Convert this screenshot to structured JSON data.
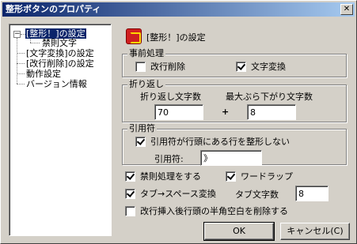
{
  "window": {
    "title": "整形ボタンのプロパティ",
    "close_glyph": "✕"
  },
  "tree": {
    "items": [
      {
        "label": "[整形！]の設定"
      },
      {
        "label": "禁則文字"
      },
      {
        "label": "[文字変換]の設定"
      },
      {
        "label": "[改行削除]の設定"
      },
      {
        "label": "動作設定"
      },
      {
        "label": "バージョン情報"
      }
    ],
    "expand_glyph": "−"
  },
  "header": {
    "title": "[整形！]の設定",
    "icon": "format-button-icon"
  },
  "preprocess": {
    "legend": "事前処理",
    "remove_newline": {
      "label": "改行削除",
      "checked": false
    },
    "char_convert": {
      "label": "文字変換",
      "checked": true
    }
  },
  "wrap": {
    "legend": "折り返し",
    "wrap_chars_label": "折り返し文字数",
    "max_hang_label": "最大ぶら下がり文字数",
    "wrap_chars_value": "70",
    "plus": "+",
    "max_hang_value": "8"
  },
  "quote": {
    "legend": "引用符",
    "format_quoted": {
      "label": "引用符が行頭にある行を整形しない",
      "checked": true
    },
    "quote_label": "引用符:",
    "quote_value": "》"
  },
  "options": {
    "kinsoku": {
      "label": "禁則処理をする",
      "checked": true
    },
    "wordwrap": {
      "label": "ワードラップ",
      "checked": true
    },
    "tab_to_space": {
      "label": "タブ→スペース変換",
      "checked": true
    },
    "tab_chars_label": "タブ文字数",
    "tab_chars_value": "8",
    "remove_half_space": {
      "label": "改行挿入後行頭の半角空白を削除する",
      "checked": false
    }
  },
  "buttons": {
    "ok": "OK",
    "cancel": "キャンセル(C)"
  }
}
